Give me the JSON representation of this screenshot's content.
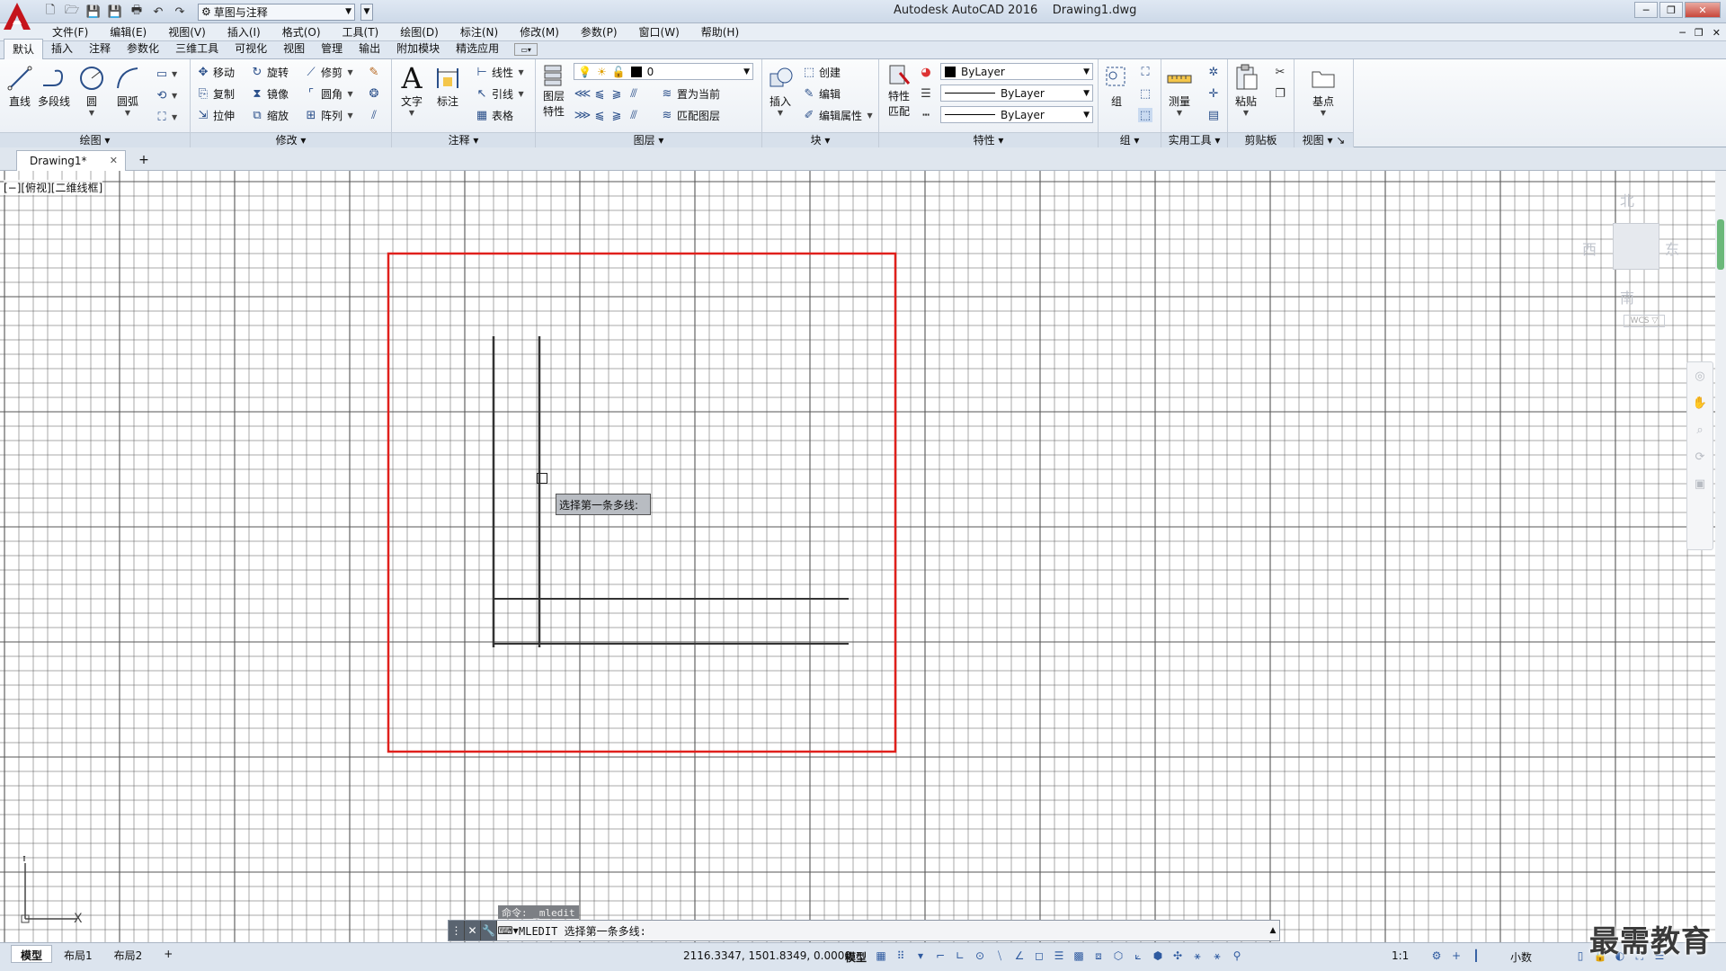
{
  "titlebar": {
    "workspace": "草图与注释",
    "app_name": "Autodesk AutoCAD 2016",
    "document": "Drawing1.dwg"
  },
  "menu": [
    "文件(F)",
    "编辑(E)",
    "视图(V)",
    "插入(I)",
    "格式(O)",
    "工具(T)",
    "绘图(D)",
    "标注(N)",
    "修改(M)",
    "参数(P)",
    "窗口(W)",
    "帮助(H)"
  ],
  "ribbon_tabs": [
    "默认",
    "插入",
    "注释",
    "参数化",
    "三维工具",
    "可视化",
    "视图",
    "管理",
    "输出",
    "附加模块",
    "精选应用"
  ],
  "panels": {
    "draw": {
      "title": "绘图",
      "line": "直线",
      "polyline": "多段线",
      "circle": "圆",
      "arc": "圆弧"
    },
    "modify": {
      "title": "修改",
      "move": "移动",
      "rotate": "旋转",
      "trim": "修剪",
      "copy": "复制",
      "mirror": "镜像",
      "fillet": "圆角",
      "stretch": "拉伸",
      "scale": "缩放",
      "array": "阵列"
    },
    "annotation": {
      "title": "注释",
      "text": "文字",
      "dimension": "标注",
      "linear": "线性",
      "leader": "引线",
      "table": "表格"
    },
    "layers": {
      "title": "图层",
      "properties": "图层",
      "properties2": "特性",
      "current_layer": "0",
      "set_current": "置为当前",
      "match_layer": "匹配图层"
    },
    "block": {
      "title": "块",
      "insert": "插入",
      "create": "创建",
      "edit": "编辑",
      "edit_attr": "编辑属性"
    },
    "properties": {
      "title": "特性",
      "match": "特性",
      "match2": "匹配",
      "color": "ByLayer",
      "linetype": "ByLayer",
      "lineweight": "ByLayer"
    },
    "groups": {
      "title": "组",
      "group": "组"
    },
    "utilities": {
      "title": "实用工具",
      "measure": "测量"
    },
    "clipboard": {
      "title": "剪贴板",
      "paste": "粘贴"
    },
    "view": {
      "title": "视图",
      "base": "基点"
    }
  },
  "file_tab": "Drawing1*",
  "viewport_label": "[−][俯视][二维线框]",
  "tooltip": "选择第一条多线:",
  "viewcube": {
    "north": "北",
    "south": "南",
    "east": "东",
    "west": "西",
    "wcs": "WCS ▽"
  },
  "ucs": {
    "x": "X",
    "y": "Y"
  },
  "command": {
    "history": "命令: _mledit",
    "current": "MLEDIT 选择第一条多线:"
  },
  "layout_tabs": [
    "模型",
    "布局1",
    "布局2"
  ],
  "status": {
    "coords": "2116.3347, 1501.8349, 0.0000",
    "model": "模型",
    "scale": "1:1",
    "units": "小数"
  },
  "watermark": "最需教育",
  "colors": {
    "selection_frame": "#e0201c",
    "grid": "#555555",
    "lines": "#333333"
  }
}
